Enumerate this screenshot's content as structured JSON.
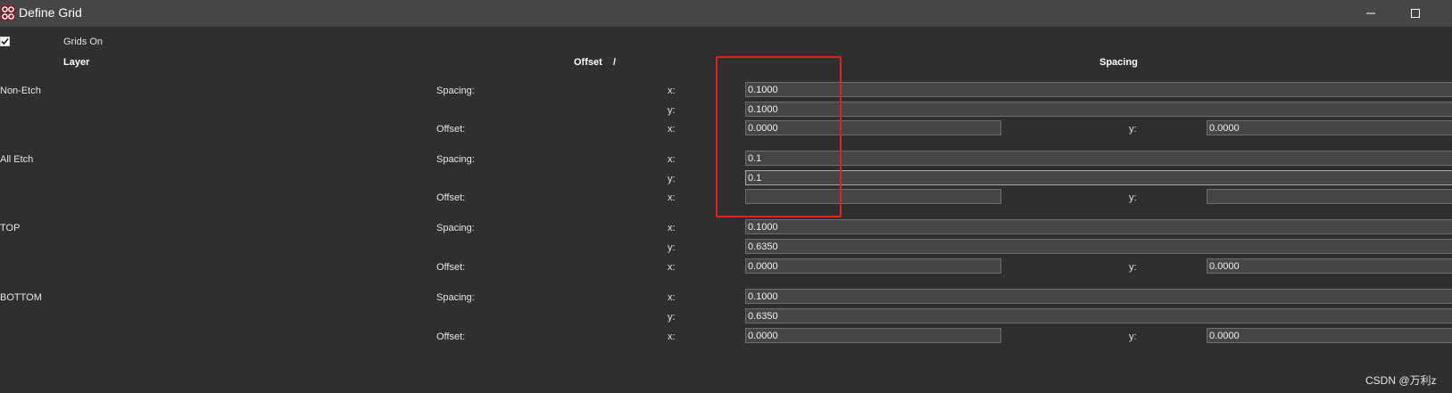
{
  "window": {
    "title": "Define Grid"
  },
  "options": {
    "grids_on_label": "Grids On",
    "grids_on_checked": true
  },
  "headers": {
    "layer": "Layer",
    "offset": "Offset",
    "divider": "/",
    "spacing": "Spacing"
  },
  "labels": {
    "spacing": "Spacing:",
    "offset": "Offset:",
    "x": "x:",
    "y": "y:"
  },
  "layers": [
    {
      "name": "Non-Etch",
      "spacing_x": "0.1000",
      "spacing_y": "0.1000",
      "offset_x": "0.0000",
      "offset_y": "0.0000"
    },
    {
      "name": "All Etch",
      "spacing_x": "0.1",
      "spacing_y": "0.1",
      "offset_x": "",
      "offset_y": ""
    },
    {
      "name": "TOP",
      "spacing_x": "0.1000",
      "spacing_y": "0.6350",
      "offset_x": "0.0000",
      "offset_y": "0.0000"
    },
    {
      "name": "BOTTOM",
      "spacing_x": "0.1000",
      "spacing_y": "0.6350",
      "offset_x": "0.0000",
      "offset_y": "0.0000"
    }
  ],
  "watermark": "CSDN @万利z",
  "colors": {
    "highlight": "#e0231b",
    "background": "#2f2f2f",
    "titlebar": "#464646"
  }
}
